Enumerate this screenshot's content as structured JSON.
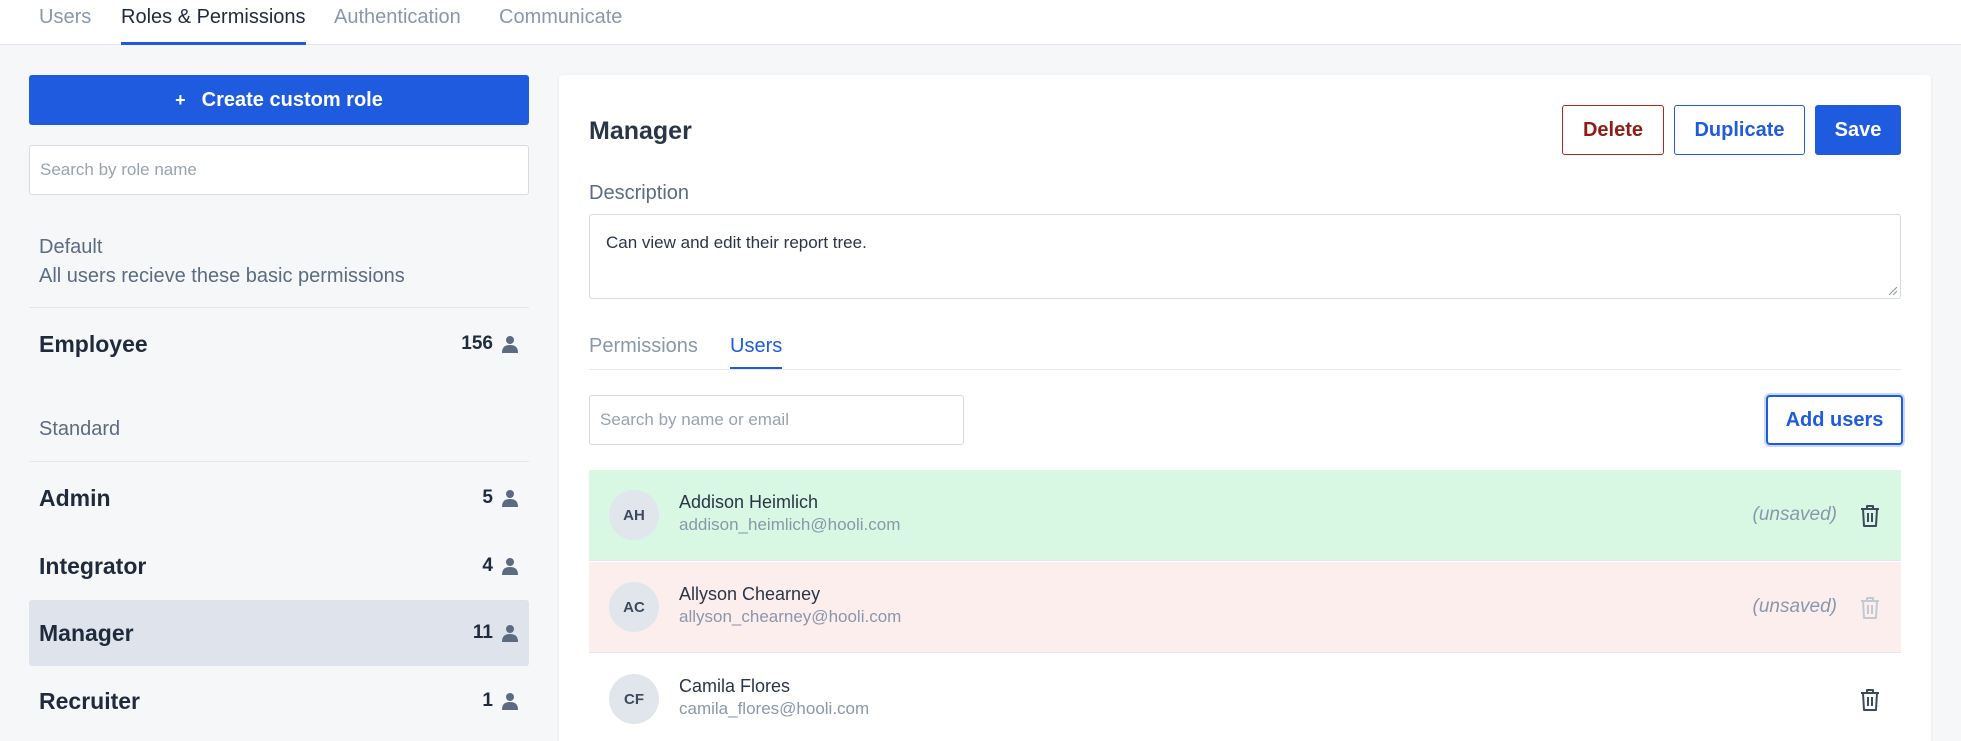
{
  "topnav": {
    "tabs": [
      {
        "label": "Users"
      },
      {
        "label": "Roles & Permissions"
      },
      {
        "label": "Authentication"
      },
      {
        "label": "Communicate"
      }
    ]
  },
  "sidebar": {
    "create_button_label": "Create custom role",
    "create_button_icon": "+",
    "search_placeholder": "Search by role name",
    "default_group": {
      "title": "Default",
      "subtitle": "All users recieve these basic permissions",
      "roles": [
        {
          "name": "Employee",
          "count": "156"
        }
      ]
    },
    "standard_group": {
      "title": "Standard",
      "roles": [
        {
          "name": "Admin",
          "count": "5"
        },
        {
          "name": "Integrator",
          "count": "4"
        },
        {
          "name": "Manager",
          "count": "11"
        },
        {
          "name": "Recruiter",
          "count": "1"
        }
      ]
    }
  },
  "panel": {
    "title": "Manager",
    "delete_label": "Delete",
    "duplicate_label": "Duplicate",
    "save_label": "Save",
    "description_label": "Description",
    "description_value": "Can view and edit their report tree.",
    "tabs": [
      {
        "label": "Permissions"
      },
      {
        "label": "Users"
      }
    ],
    "user_search_placeholder": "Search by name or email",
    "add_users_label": "Add users",
    "users": [
      {
        "initials": "AH",
        "name": "Addison Heimlich",
        "email": "addison_heimlich@hooli.com",
        "status": "(unsaved)"
      },
      {
        "initials": "AC",
        "name": "Allyson Chearney",
        "email": "allyson_chearney@hooli.com",
        "status": "(unsaved)"
      },
      {
        "initials": "CF",
        "name": "Camila Flores",
        "email": "camila_flores@hooli.com",
        "status": ""
      }
    ]
  },
  "colors": {
    "primary": "#1f5bdf",
    "danger": "#b3261e",
    "added_row": "#d8f8e4",
    "removed_row": "#fdeeee"
  }
}
